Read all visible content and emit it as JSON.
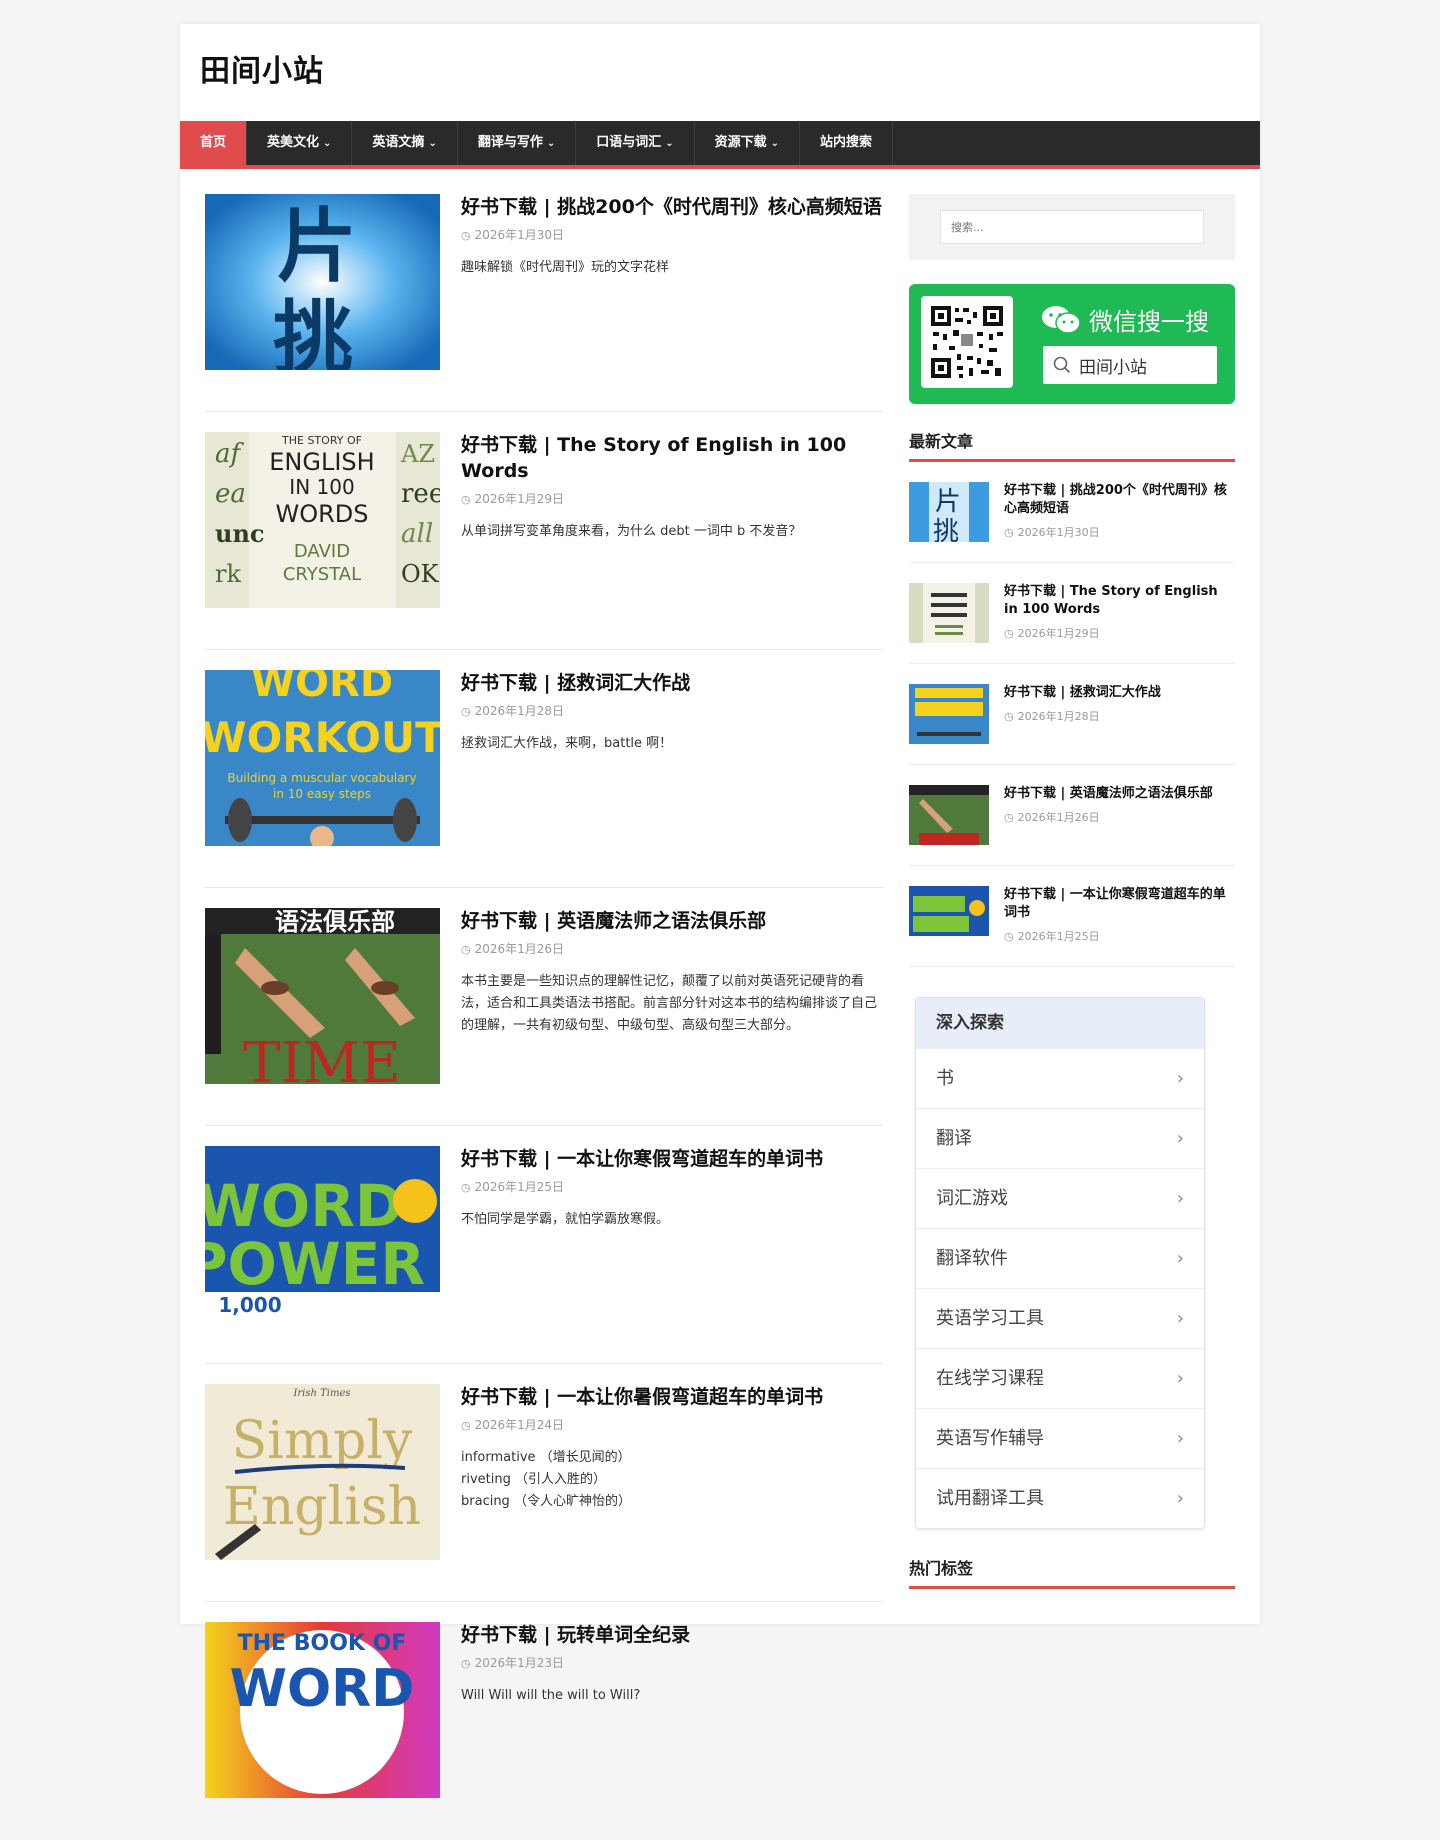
{
  "site": {
    "title": "田间小站"
  },
  "nav": [
    {
      "label": "首页",
      "has_menu": false,
      "active": true
    },
    {
      "label": "英美文化",
      "has_menu": true
    },
    {
      "label": "英语文摘",
      "has_menu": true
    },
    {
      "label": "翻译与写作",
      "has_menu": true
    },
    {
      "label": "口语与词汇",
      "has_menu": true
    },
    {
      "label": "资源下载",
      "has_menu": true
    },
    {
      "label": "站内搜索",
      "has_menu": false
    }
  ],
  "articles": [
    {
      "title": "好书下载 | 挑战200个《时代周刊》核心高频短语",
      "date": "2026年1月30日",
      "excerpt": [
        "趣味解锁《时代周刊》玩的文字花样"
      ],
      "thumb": {
        "big": "片\n挑",
        "colors": [
          "#1a7fd0",
          "#0d4b82"
        ]
      }
    },
    {
      "title": "好书下载 | The Story of English in 100 Words",
      "date": "2026年1月29日",
      "excerpt": [
        "从单词拼写变革角度来看，为什么 debt 一词中 b 不发音？"
      ],
      "thumb": {
        "lines": [
          "THE STORY OF",
          "ENGLISH",
          "IN 100",
          "WORDS",
          "DAVID",
          "CRYSTAL"
        ]
      }
    },
    {
      "title": "好书下载 | 拯救词汇大作战",
      "date": "2026年1月28日",
      "excerpt": [
        "拯救词汇大作战，来啊，battle 啊！"
      ],
      "thumb": {
        "lines": [
          "WORD",
          "WORKOUT",
          "Building a muscular vocabulary",
          "in 10 easy steps"
        ]
      }
    },
    {
      "title": "好书下载 | 英语魔法师之语法俱乐部",
      "date": "2026年1月26日",
      "excerpt": [
        "本书主要是一些知识点的理解性记忆，颠覆了以前对英语死记硬背的看法，适合和工具类语法书搭配。前言部分针对这本书的结构编排谈了自己的理解，一共有初级句型、中级句型、高级句型三大部分。"
      ],
      "thumb": {
        "lines": [
          "语法俱乐部",
          "TIME"
        ]
      }
    },
    {
      "title": "好书下载 | 一本让你寒假弯道超车的单词书",
      "date": "2026年1月25日",
      "excerpt": [
        "不怕同学是学霸，就怕学霸放寒假。"
      ],
      "thumb": {
        "lines": [
          "WORD",
          "POWER",
          "1,000"
        ]
      }
    },
    {
      "title": "好书下载 | 一本让你暑假弯道超车的单词书",
      "date": "2026年1月24日",
      "excerpt": [
        "informative （增长见闻的）",
        "riveting （引人入胜的）",
        "bracing （令人心旷神怡的）"
      ],
      "thumb": {
        "lines": [
          "Irish Times",
          "Simply",
          "English"
        ]
      }
    },
    {
      "title": "好书下载 | 玩转单词全纪录",
      "date": "2026年1月23日",
      "excerpt": [
        "Will Will will the will to Will?"
      ],
      "thumb": {
        "lines": [
          "THE BOOK OF",
          "WORD"
        ]
      }
    }
  ],
  "search": {
    "placeholder": "搜索..."
  },
  "wechat": {
    "title": "微信搜一搜",
    "query": "田间小站"
  },
  "recent": {
    "heading": "最新文章",
    "items": [
      {
        "title": "好书下载 | 挑战200个《时代周刊》核心高频短语",
        "date": "2026年1月30日"
      },
      {
        "title": "好书下载 | The Story of English in 100 Words",
        "date": "2026年1月29日"
      },
      {
        "title": "好书下载 | 拯救词汇大作战",
        "date": "2026年1月28日"
      },
      {
        "title": "好书下载 | 英语魔法师之语法俱乐部",
        "date": "2026年1月26日"
      },
      {
        "title": "好书下载 | 一本让你寒假弯道超车的单词书",
        "date": "2026年1月25日"
      }
    ]
  },
  "explore": {
    "heading": "深入探索",
    "items": [
      "书",
      "翻译",
      "词汇游戏",
      "翻译软件",
      "英语学习工具",
      "在线学习课程",
      "英语写作辅导",
      "试用翻译工具"
    ]
  },
  "tags": {
    "heading": "热门标签"
  },
  "colors": {
    "accent": "#e04b4b",
    "nav_bg": "#2a2a2a",
    "wechat_green": "#1fba53"
  }
}
